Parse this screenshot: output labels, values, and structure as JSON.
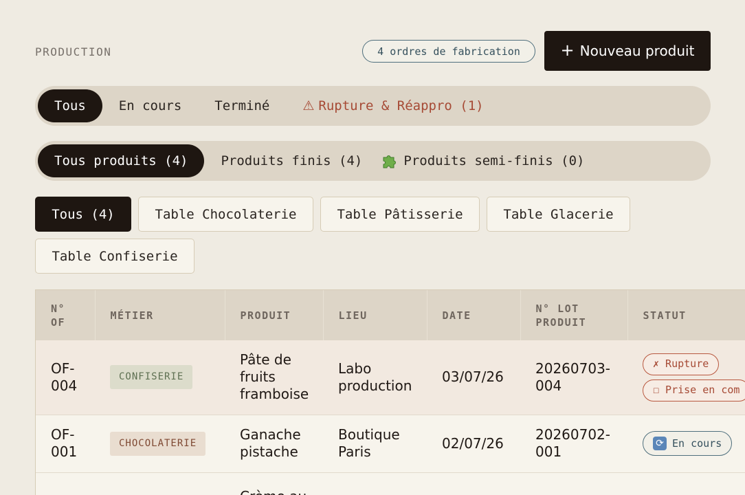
{
  "header": {
    "section_label": "PRODUCTION",
    "count_badge": "4 ordres de fabrication",
    "new_button": {
      "icon": "plus-icon",
      "label": "Nouveau produit"
    }
  },
  "status_filters": [
    {
      "label": "Tous",
      "active": true
    },
    {
      "label": "En cours",
      "active": false
    },
    {
      "label": "Terminé",
      "active": false
    },
    {
      "label": "Rupture & Réappro (1)",
      "icon": "⚠",
      "active": false
    }
  ],
  "product_filters": [
    {
      "label": "Tous produits (4)",
      "active": true
    },
    {
      "label": "Produits finis (4)",
      "active": false
    },
    {
      "label": "Produits semi-finis (0)",
      "icon": "puzzle-icon",
      "active": false
    }
  ],
  "table_tabs": [
    {
      "label": "Tous (4)",
      "active": true
    },
    {
      "label": "Table Chocolaterie",
      "active": false
    },
    {
      "label": "Table Pâtisserie",
      "active": false
    },
    {
      "label": "Table Glacerie",
      "active": false
    },
    {
      "label": "Table Confiserie",
      "active": false
    }
  ],
  "table": {
    "columns": [
      "N° OF",
      "MÉTIER",
      "PRODUIT",
      "LIEU",
      "DATE",
      "N° LOT PRODUIT",
      "STATUT"
    ],
    "rows": [
      {
        "of": "OF-004",
        "metier": "CONFISERIE",
        "produit": "Pâte de fruits framboise",
        "lieu": "Labo production",
        "date": "03/07/26",
        "lot": "20260703-004",
        "statuts": [
          "✗ Rupture",
          "☐ Prise en com"
        ]
      },
      {
        "of": "OF-001",
        "metier": "CHOCOLATERIE",
        "produit": "Ganache pistache",
        "lieu": "Boutique Paris",
        "date": "02/07/26",
        "lot": "20260702-001",
        "statuts": [
          "En cours"
        ]
      },
      {
        "produit": "Crème au"
      }
    ]
  },
  "colors": {
    "background": "#efebe2",
    "dark": "#1e1611",
    "alert": "#a64a35",
    "info": "#35505d"
  }
}
